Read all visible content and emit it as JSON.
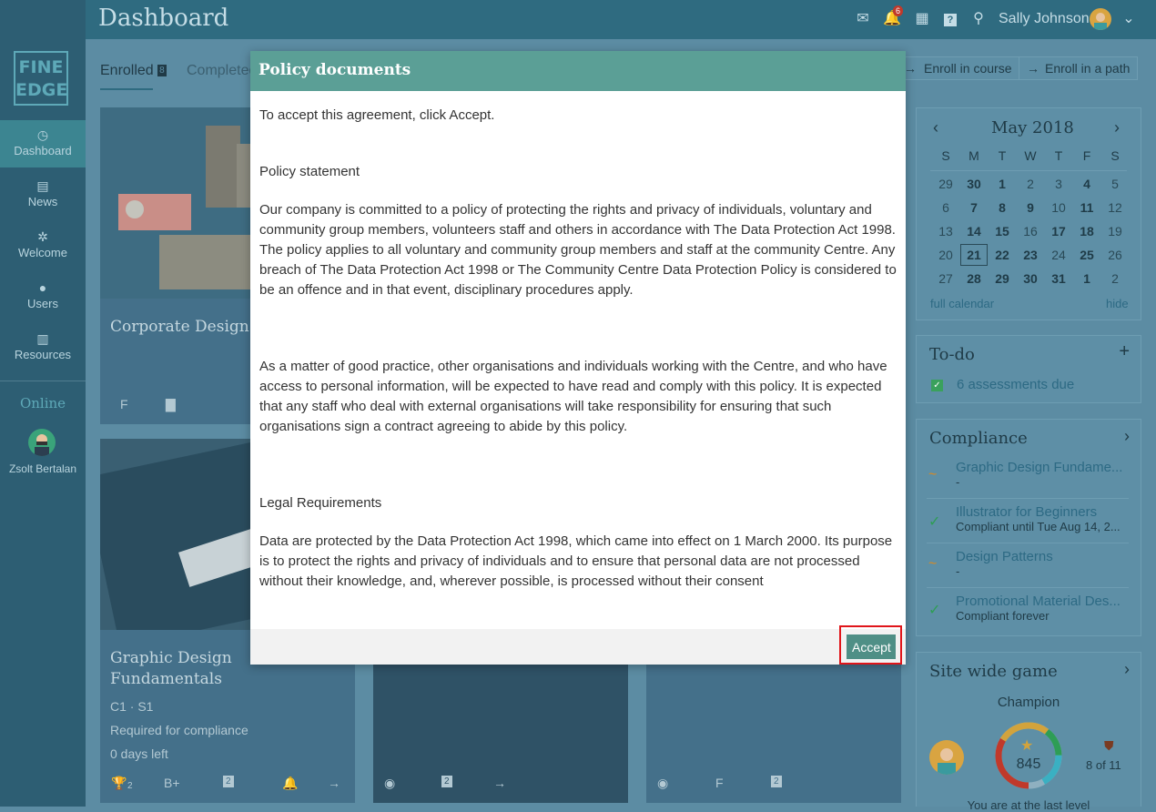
{
  "header": {
    "title": "Dashboard",
    "notifications_count": "6",
    "username": "Sally Johnson"
  },
  "sidebar": {
    "logo_line1": "FINE",
    "logo_line2": "EDGE",
    "items": [
      {
        "label": "Dashboard",
        "icon": "dashboard-icon"
      },
      {
        "label": "News",
        "icon": "news-icon"
      },
      {
        "label": "Welcome",
        "icon": "welcome-icon"
      },
      {
        "label": "Users",
        "icon": "user-icon"
      },
      {
        "label": "Resources",
        "icon": "resources-icon"
      }
    ],
    "online_label": "Online",
    "online_user": "Zsolt Bertalan"
  },
  "main": {
    "tabs": [
      {
        "label": "Enrolled",
        "count": "8"
      },
      {
        "label": "Completed"
      }
    ],
    "enroll_course": "Enroll in course",
    "enroll_path": "Enroll in a path",
    "cards": [
      {
        "title": "Corporate Design",
        "icon_label": "F"
      },
      {
        "title": "Graphic Design Fundamentals",
        "code": "C1 · S1",
        "requirement": "Required for compliance",
        "days": "0 days left",
        "trophy": "2",
        "grade": "B+",
        "doc_count": "2"
      },
      {
        "title": "",
        "doc_count": "2"
      },
      {
        "title": "",
        "icon_label": "F",
        "doc_count": "2"
      }
    ]
  },
  "calendar": {
    "month": "May 2018",
    "weekdays": [
      "S",
      "M",
      "T",
      "W",
      "T",
      "F",
      "S"
    ],
    "weeks": [
      [
        "29",
        "30",
        "1",
        "2",
        "3",
        "4",
        "5"
      ],
      [
        "6",
        "7",
        "8",
        "9",
        "10",
        "11",
        "12"
      ],
      [
        "13",
        "14",
        "15",
        "16",
        "17",
        "18",
        "19"
      ],
      [
        "20",
        "21",
        "22",
        "23",
        "24",
        "25",
        "26"
      ],
      [
        "27",
        "28",
        "29",
        "30",
        "31",
        "1",
        "2"
      ]
    ],
    "full_calendar": "full calendar",
    "hide": "hide"
  },
  "todo": {
    "title": "To-do",
    "item": "6 assessments due"
  },
  "compliance": {
    "title": "Compliance",
    "items": [
      {
        "title": "Graphic Design Fundame...",
        "sub": "-",
        "status": "pending"
      },
      {
        "title": "Illustrator for Beginners",
        "sub": "Compliant until Tue Aug 14, 2...",
        "status": "ok"
      },
      {
        "title": "Design Patterns",
        "sub": "-",
        "status": "pending"
      },
      {
        "title": "Promotional Material Des...",
        "sub": "Compliant forever",
        "status": "ok"
      }
    ]
  },
  "game": {
    "title": "Site wide game",
    "level": "Champion",
    "points": "845",
    "badges": "8 of 11",
    "footer": "You are at the last level"
  },
  "modal": {
    "title": "Policy documents",
    "intro": "To accept this agreement, click Accept.",
    "heading1": "Policy statement",
    "para1": "Our company is committed to a policy of protecting the rights and privacy of individuals, voluntary and community group members, volunteers staff and others in accordance with The Data Protection Act 1998. The policy applies to all voluntary and community group members and staff at the community Centre. Any breach of The Data Protection Act 1998 or The Community Centre Data Protection Policy is considered to be an offence and in that event, disciplinary procedures apply.",
    "para2": "As a matter of good practice, other organisations and individuals working with the Centre, and who have access to personal information, will be expected to have read and comply with this policy. It is expected that any staff who deal with external organisations will take responsibility for ensuring that such organisations sign a contract agreeing to abide by this policy.",
    "heading2": "Legal Requirements",
    "para3": "Data are protected by the Data Protection Act 1998, which came into effect on 1 March 2000. Its purpose is to protect the rights and privacy of individuals and to ensure that personal data are not processed without their knowledge, and, wherever possible, is processed without their consent",
    "accept_label": "Accept"
  },
  "colors": {
    "accent": "#5b9f96",
    "highlight": "#e0151a"
  }
}
